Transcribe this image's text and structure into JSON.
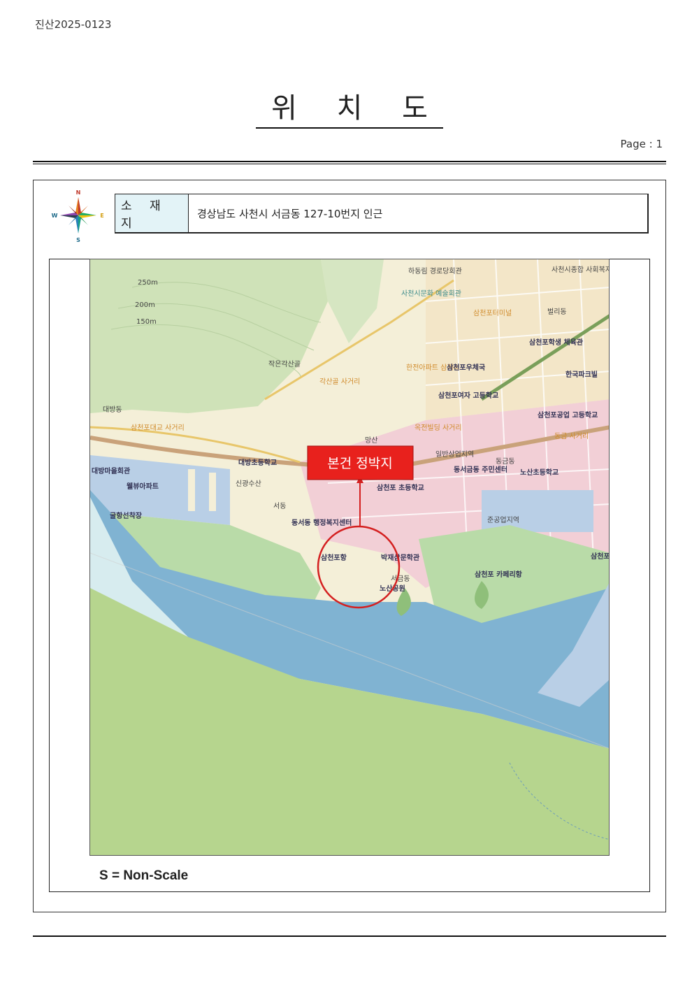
{
  "header": {
    "doc_number": "진산2025-0123",
    "title": "위 치 도",
    "page_label": "Page : 1"
  },
  "compass": {
    "n": "N",
    "s": "S",
    "e": "E",
    "w": "W"
  },
  "address": {
    "label": "소 재 지",
    "value": "경상남도 사천시 서금동 127-10번지 인근"
  },
  "map": {
    "callout": "본건 정박지",
    "labels": [
      "하동림 경로당회관",
      "사천시종합 사회복지관",
      "사천시문화 예술회관",
      "삼천포터미널",
      "벌리동",
      "삼천포학생 체육관",
      "한국파크빌",
      "작은각산골",
      "한전아파트 삼거리",
      "삼천포우체국",
      "각산골 사거리",
      "삼천포여자 고등학교",
      "삼천포공업 고등학교",
      "대방동",
      "삼천포대교 사거리",
      "망산",
      "옥전빌딩 사거리",
      "동금 사거리",
      "대방초등학교",
      "일반상업지역",
      "동금동",
      "대방마을회관",
      "동서금동 주민센터",
      "노산초등학교",
      "웰뷰아파트",
      "신광수산",
      "삼천포 초등학교",
      "굴항선착장",
      "서동",
      "동서동 행정복지센터",
      "준공업지역",
      "삼천포항",
      "박재삼문학관",
      "서금동",
      "노산공원",
      "삼천포 카페리항",
      "삼천포",
      "250m",
      "200m",
      "150m"
    ]
  },
  "scale_note": "S = Non-Scale"
}
